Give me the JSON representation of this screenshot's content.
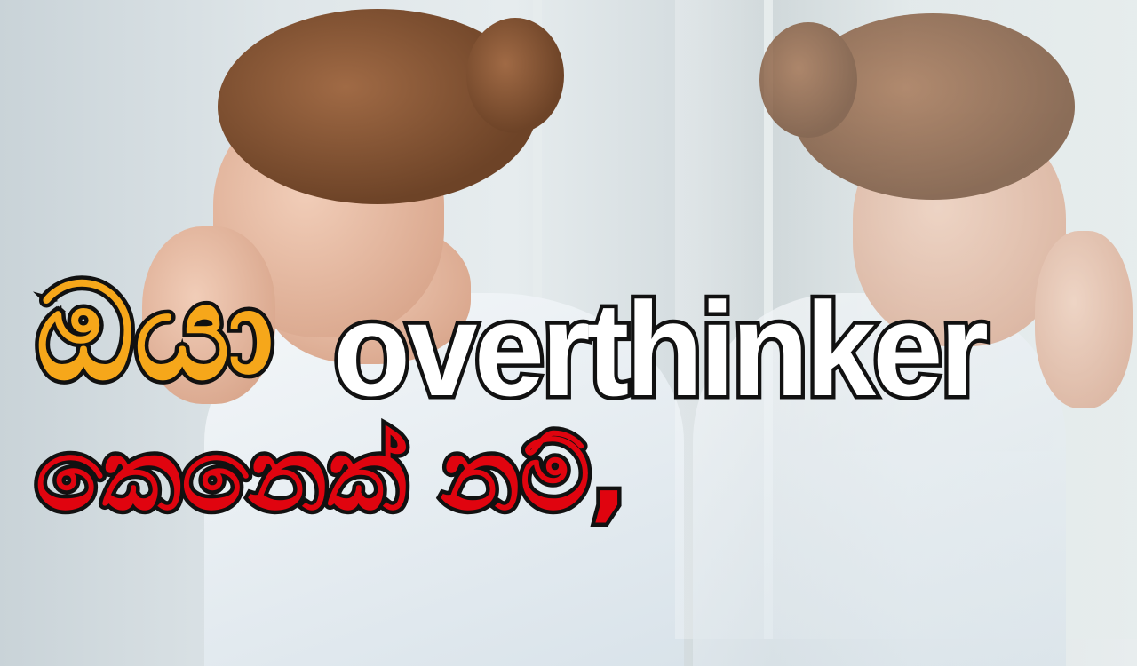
{
  "headline": {
    "word1": "ඔයා",
    "word2": "overthinker",
    "line2": "කෙනෙක් නම්,"
  },
  "colors": {
    "word1": "#f6a71a",
    "word2": "#ffffff",
    "line2": "#e0040f",
    "outline": "#111111"
  }
}
